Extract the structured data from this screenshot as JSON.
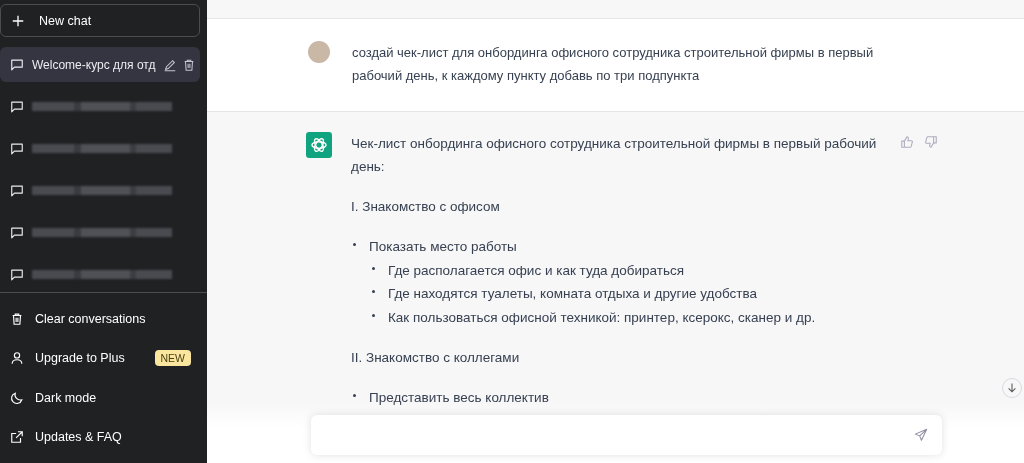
{
  "sidebar": {
    "new_chat": "New chat",
    "history": [
      {
        "kind": "chat",
        "title": "Welcome-курс для отд",
        "selected": true
      },
      {
        "kind": "redacted",
        "selected": false
      },
      {
        "kind": "redacted",
        "selected": false
      },
      {
        "kind": "redacted",
        "selected": false
      },
      {
        "kind": "redacted",
        "selected": false
      },
      {
        "kind": "redacted",
        "selected": false
      }
    ],
    "menu": [
      {
        "kind": "trash",
        "label": "Clear conversations"
      },
      {
        "kind": "user",
        "label": "Upgrade to Plus",
        "badge": "NEW"
      },
      {
        "kind": "moon",
        "label": "Dark mode"
      },
      {
        "kind": "external",
        "label": "Updates & FAQ"
      }
    ]
  },
  "conversation": {
    "user_message": "создай чек-лист для онбординга офисного сотрудника строительной фирмы в первый рабочий день, к каждому пункту добавь по три подпункта",
    "assistant_message": {
      "intro": "Чек-лист онбординга офисного сотрудника строительной фирмы в первый рабочий день:",
      "sections": [
        {
          "heading": "I. Знакомство с офисом",
          "items": [
            {
              "text": "Показать место работы",
              "children": [
                {
                  "text": "Где располагается офис и как туда добираться"
                },
                {
                  "text": "Где находятся туалеты, комната отдыха и другие удобства"
                },
                {
                  "text": "Как пользоваться офисной техникой: принтер, ксерокс, сканер и др."
                }
              ]
            }
          ]
        },
        {
          "heading": "II. Знакомство с коллегами",
          "items": [
            {
              "text": "Представить весь коллектив"
            }
          ]
        }
      ]
    }
  }
}
